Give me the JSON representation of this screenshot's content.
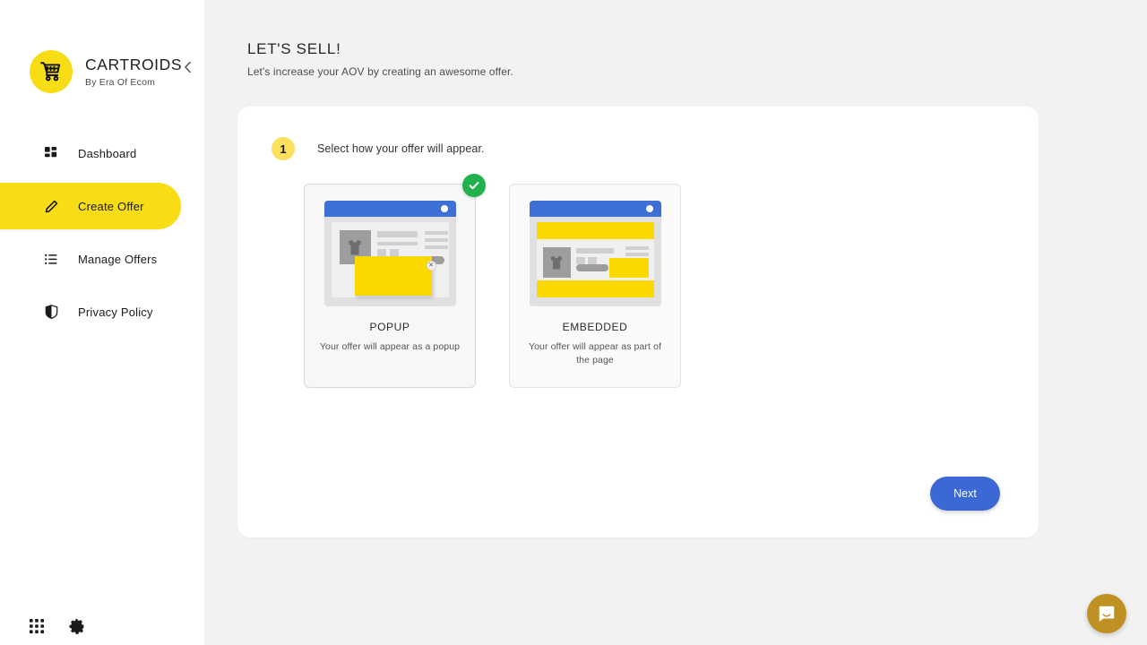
{
  "brand": {
    "name": "CARTROIDS",
    "tagline": "By Era Of Ecom",
    "logo_icon": "shopping-cart-icon",
    "collapse_icon": "chevron-left-icon",
    "accent_color": "#f8dc15"
  },
  "sidebar": {
    "items": [
      {
        "label": "Dashboard",
        "icon": "dashboard-grid-icon",
        "active": false
      },
      {
        "label": "Create Offer",
        "icon": "pencil-icon",
        "active": true
      },
      {
        "label": "Manage Offers",
        "icon": "list-icon",
        "active": false
      },
      {
        "label": "Privacy Policy",
        "icon": "shield-icon",
        "active": false
      }
    ],
    "footer": [
      {
        "icon": "apps-grid-icon"
      },
      {
        "icon": "gear-icon"
      }
    ]
  },
  "header": {
    "title": "LET'S SELL!",
    "subtitle": "Let's increase your AOV by creating an awesome offer."
  },
  "step": {
    "number": "1",
    "instruction": "Select how your offer will appear."
  },
  "options": [
    {
      "id": "popup",
      "title": "POPUP",
      "description": "Your offer will appear as a popup",
      "selected": true,
      "check_icon": "check-circle-icon",
      "close_icon": "close-x-icon"
    },
    {
      "id": "embedded",
      "title": "EMBEDDED",
      "description": "Your offer will appear as part of the page",
      "selected": false
    }
  ],
  "actions": {
    "next_label": "Next",
    "next_color": "#3b68d4"
  },
  "chat": {
    "icon": "chat-bubble-icon",
    "color": "#bf9122"
  },
  "colors": {
    "page_background": "#f2f2f2",
    "panel_background": "#ffffff",
    "brand_yellow": "#f8dc15",
    "mock_yellow": "#fbd900",
    "mock_blue": "#3d6fd4",
    "success_green": "#22b14c"
  }
}
